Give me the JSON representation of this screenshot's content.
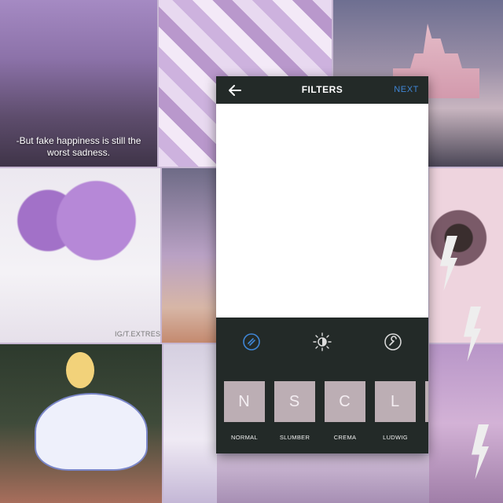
{
  "header": {
    "title": "FILTERS",
    "next_label": "NEXT",
    "back_icon": "back-arrow-icon"
  },
  "collage": {
    "quote_line1": "-But fake happiness is still the",
    "quote_line2": "worst sadness.",
    "credit": "IG/T.EXTRES"
  },
  "tools": [
    {
      "name": "filter-tool-icon",
      "active": true,
      "color": "#3f86d6"
    },
    {
      "name": "brightness-icon",
      "active": false,
      "color": "#dcdcdc"
    },
    {
      "name": "wrench-icon",
      "active": false,
      "color": "#dcdcdc"
    }
  ],
  "filters": [
    {
      "letter": "N",
      "label": "NORMAL"
    },
    {
      "letter": "S",
      "label": "SLUMBER"
    },
    {
      "letter": "C",
      "label": "CREMA"
    },
    {
      "letter": "L",
      "label": "LUDWIG"
    }
  ],
  "colors": {
    "panel_bg": "#232a28",
    "accent": "#3f86d6",
    "thumbnail": "#bcaeb4"
  }
}
